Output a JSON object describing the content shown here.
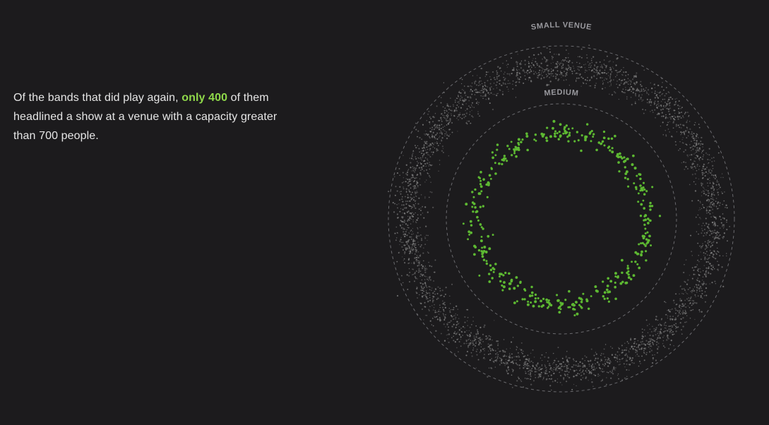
{
  "text": {
    "before": "Of the bands that did play again, ",
    "highlight": "only 400",
    "after": " of them headlined a show at a venue with a capacity greater than 700 people."
  },
  "colors": {
    "background": "#1c1b1d",
    "text": "#e6e6e6",
    "highlight": "#8fd84a",
    "small_venue_dots": "#8a8a8a",
    "medium_dots": "#5db832",
    "ring_line": "#6a6a6e",
    "ring_label": "#9a9a9f"
  },
  "chart_data": {
    "type": "scatter",
    "rings": [
      {
        "label": "SMALL VENUE"
      },
      {
        "label": "MEDIUM"
      }
    ],
    "series": [
      {
        "ring": "SMALL VENUE",
        "count": 3500
      },
      {
        "ring": "MEDIUM",
        "count": 400
      }
    ]
  }
}
